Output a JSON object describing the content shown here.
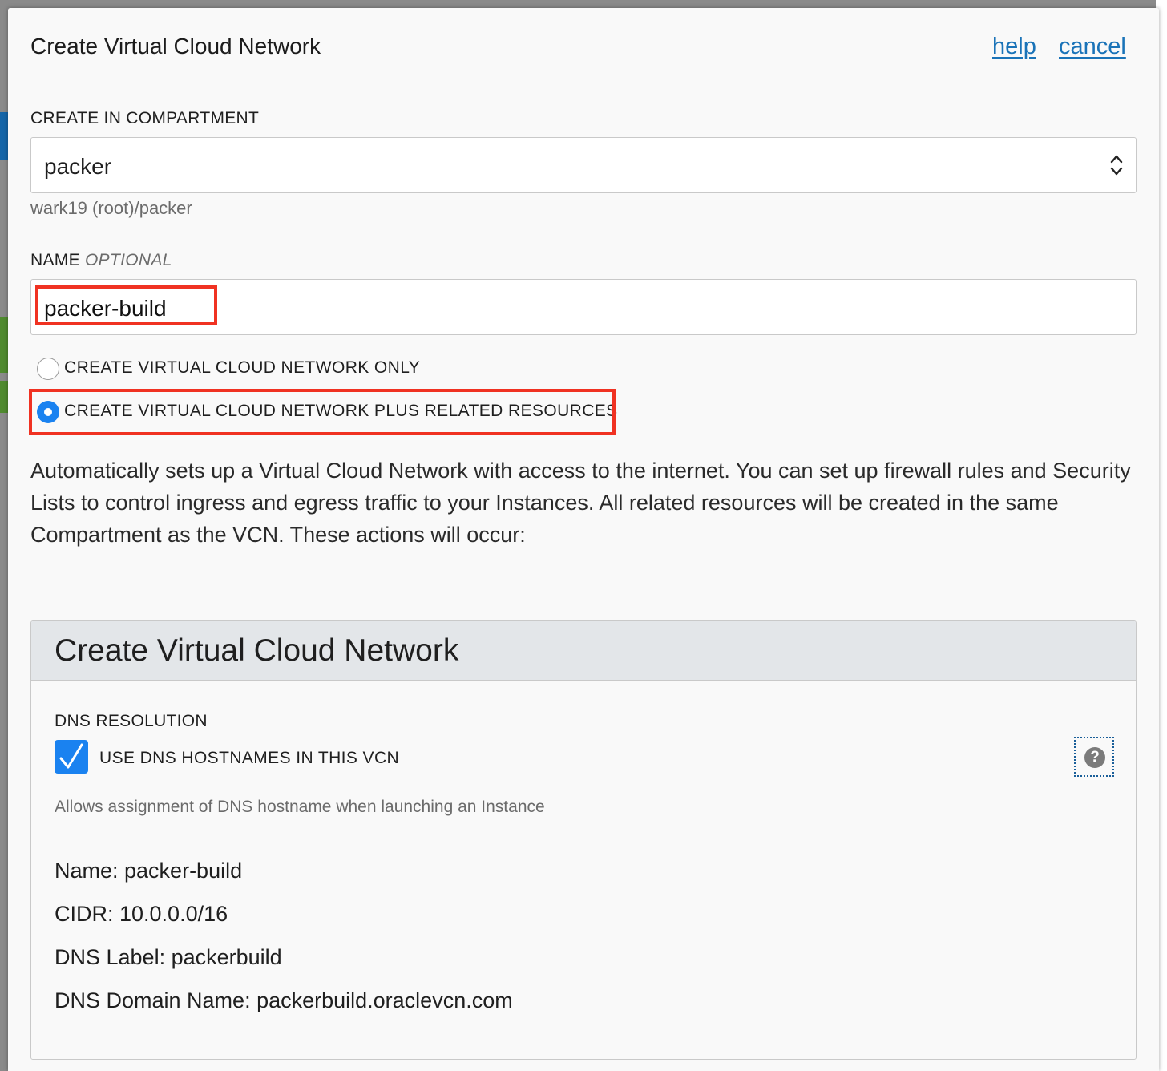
{
  "dialog": {
    "title": "Create Virtual Cloud Network",
    "help_label": "help",
    "cancel_label": "cancel"
  },
  "compartment": {
    "label": "CREATE IN COMPARTMENT",
    "selected": "packer",
    "path": "wark19 (root)/packer"
  },
  "name_field": {
    "label": "NAME",
    "optional": "OPTIONAL",
    "value": "packer-build"
  },
  "radio_options": [
    {
      "label": "CREATE VIRTUAL CLOUD NETWORK ONLY",
      "selected": false
    },
    {
      "label": "CREATE VIRTUAL CLOUD NETWORK PLUS RELATED RESOURCES",
      "selected": true
    }
  ],
  "description": "Automatically sets up a Virtual Cloud Network with access to the internet. You can set up firewall rules and Security Lists to control ingress and egress traffic to your Instances. All related resources will be created in the same Compartment as the VCN. These actions will occur:",
  "panel": {
    "title": "Create Virtual Cloud Network",
    "dns_label": "DNS RESOLUTION",
    "dns_checkbox_label": "USE DNS HOSTNAMES IN THIS VCN",
    "dns_checked": true,
    "dns_hint": "Allows assignment of DNS hostname when launching an Instance",
    "help_icon": "question-icon",
    "summary": [
      "Name: packer-build",
      "CIDR: 10.0.0.0/16",
      "DNS Label: packerbuild",
      "DNS Domain Name: packerbuild.oraclevcn.com"
    ]
  },
  "colors": {
    "accent": "#1a82f0",
    "link": "#1a73b8",
    "highlight": "#f03222"
  }
}
